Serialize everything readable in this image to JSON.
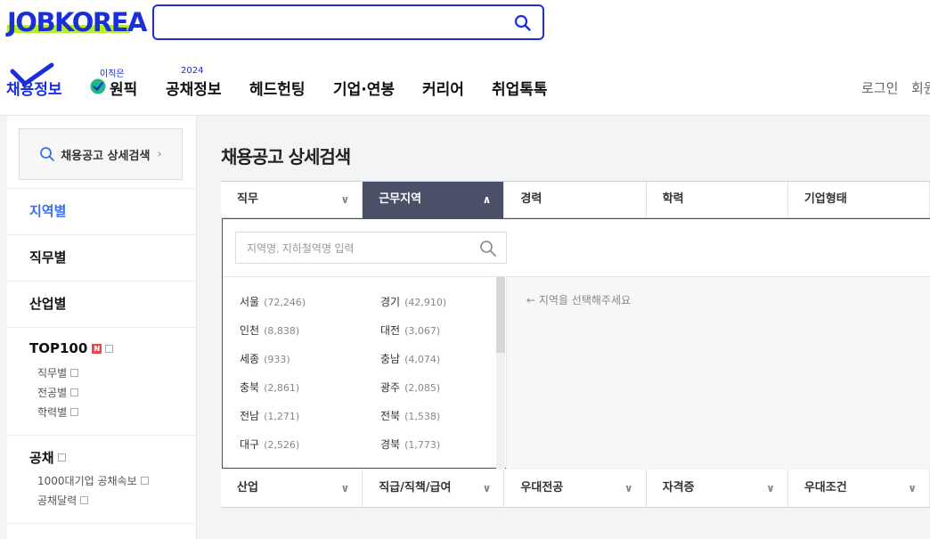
{
  "header": {
    "logo": "JOBKOREA",
    "search_placeholder": "",
    "nav": [
      {
        "label": "채용정보",
        "sup": ""
      },
      {
        "label": "원픽",
        "sup": "이직은"
      },
      {
        "label": "공채정보",
        "sup": "2024"
      },
      {
        "label": "헤드헌팅",
        "sup": ""
      },
      {
        "label": "기업·연봉",
        "sup": ""
      },
      {
        "label": "커리어",
        "sup": ""
      },
      {
        "label": "취업톡톡",
        "sup": ""
      }
    ],
    "login": "로그인",
    "signup": "회원"
  },
  "sidebar": {
    "advanced_search": "채용공고 상세검색",
    "categories": [
      "지역별",
      "직무별",
      "산업별"
    ],
    "top100": {
      "label": "TOP100",
      "badge": "N",
      "subs": [
        "직무별",
        "전공별",
        "학력별"
      ]
    },
    "gongchae": {
      "label": "공채",
      "subs": [
        "1000대기업 공채속보",
        "공채달력"
      ]
    }
  },
  "main": {
    "title": "채용공고 상세검색",
    "tabs": [
      "직무",
      "근무지역",
      "경력",
      "학력",
      "기업형태"
    ],
    "region_search_placeholder": "지역명, 지하철역명 입력",
    "regions": [
      {
        "name": "서울",
        "count": "(72,246)"
      },
      {
        "name": "경기",
        "count": "(42,910)"
      },
      {
        "name": "인천",
        "count": "(8,838)"
      },
      {
        "name": "대전",
        "count": "(3,067)"
      },
      {
        "name": "세종",
        "count": "(933)"
      },
      {
        "name": "충남",
        "count": "(4,074)"
      },
      {
        "name": "충북",
        "count": "(2,861)"
      },
      {
        "name": "광주",
        "count": "(2,085)"
      },
      {
        "name": "전남",
        "count": "(1,271)"
      },
      {
        "name": "전북",
        "count": "(1,538)"
      },
      {
        "name": "대구",
        "count": "(2,526)"
      },
      {
        "name": "경북",
        "count": "(1,773)"
      }
    ],
    "hint": "← 지역을 선택해주세요",
    "tabs2": [
      "산업",
      "직급/직책/급여",
      "우대전공",
      "자격증",
      "우대조건"
    ]
  }
}
